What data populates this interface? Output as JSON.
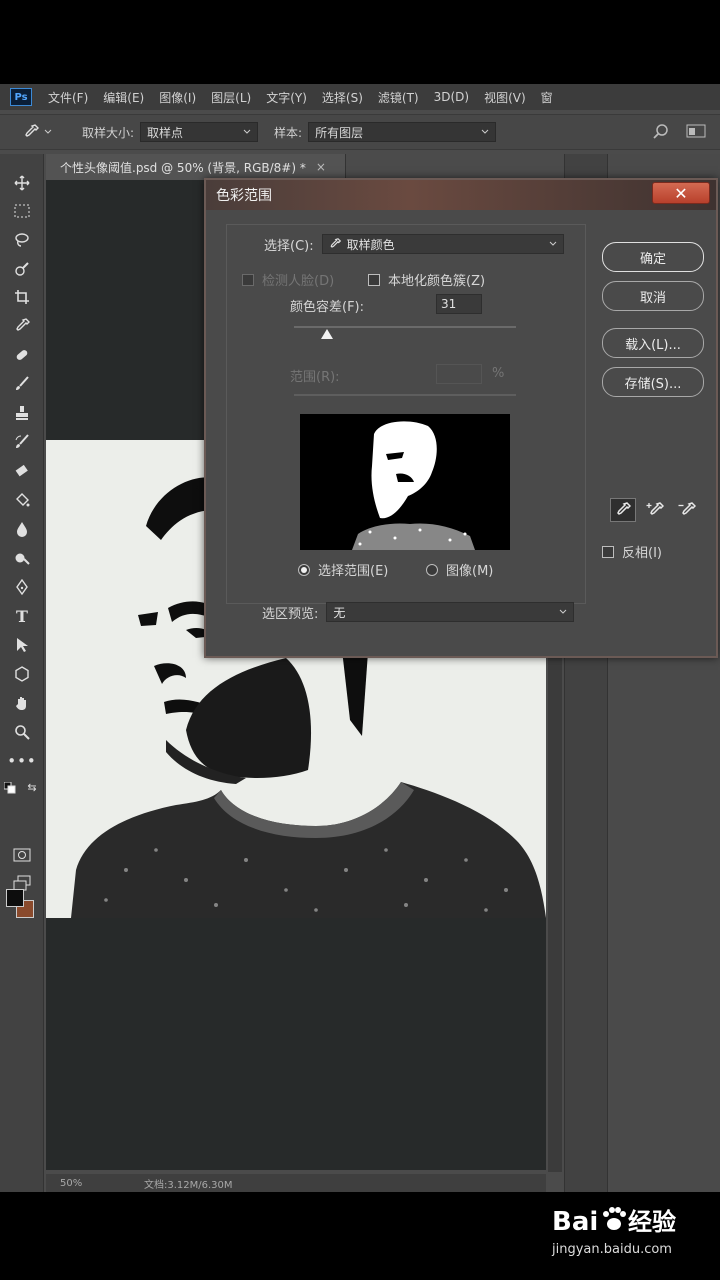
{
  "app": {
    "logo": "Ps"
  },
  "menu": [
    "文件(F)",
    "编辑(E)",
    "图像(I)",
    "图层(L)",
    "文字(Y)",
    "选择(S)",
    "滤镜(T)",
    "3D(D)",
    "视图(V)",
    "窗"
  ],
  "options": {
    "sample_size_label": "取样大小:",
    "sample_size_value": "取样点",
    "sample_label": "样本:",
    "sample_value": "所有图层"
  },
  "document": {
    "tab_title": "个性头像阈值.psd @ 50% (背景, RGB/8#) *",
    "close": "×",
    "zoom": "50%",
    "doc_info": "文档:3.12M/6.30M"
  },
  "dialog": {
    "title": "色彩范围",
    "close": "✕",
    "select_label": "选择(C):",
    "select_value": "取样颜色",
    "detect_faces_label": "检测人脸(D)",
    "localized_label": "本地化颜色簇(Z)",
    "fuzziness_label": "颜色容差(F):",
    "fuzziness_value": "31",
    "fuzziness_fraction": 0.15,
    "range_label": "范围(R):",
    "range_unit": "%",
    "radio_selection": "选择范围(E)",
    "radio_image": "图像(M)",
    "preview_label": "选区预览:",
    "preview_value": "无",
    "buttons": {
      "ok": "确定",
      "cancel": "取消",
      "load": "载入(L)...",
      "save": "存储(S)..."
    },
    "invert_label": "反相(I)"
  },
  "watermark": {
    "logo": "Bai du 经验",
    "url": "jingyan.baidu.com"
  }
}
